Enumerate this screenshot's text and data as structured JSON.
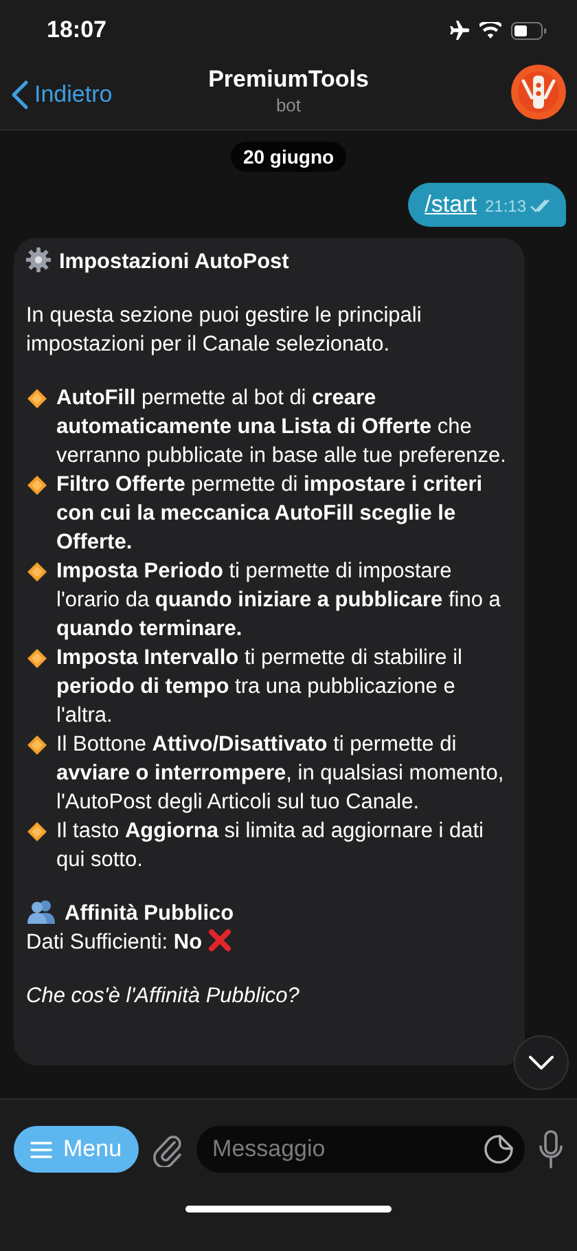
{
  "status_bar": {
    "time": "18:07"
  },
  "header": {
    "back": "Indietro",
    "title": "PremiumTools",
    "subtitle": "bot"
  },
  "date": "20 giugno",
  "outgoing": {
    "text": "/start",
    "time": "21:13"
  },
  "message": {
    "sections": [
      [
        {
          "kind": "settings_heading",
          "text": "Impostazioni AutoPost"
        }
      ],
      [
        {
          "kind": "text",
          "text": "In questa sezione puoi gestire le principali impostazioni per il Canale selezionato."
        }
      ],
      [
        {
          "kind": "bullet",
          "text": "**AutoFill** permette al bot di **creare automaticamente una Lista di Offerte** che verranno pubblicate in base alle tue preferenze."
        },
        {
          "kind": "bullet",
          "text": "**Filtro Offerte** permette di **impostare i criteri con cui la meccanica AutoFill sceglie le Offerte.**"
        },
        {
          "kind": "bullet",
          "text": "**Imposta Periodo** ti permette di impostare l'orario da **quando iniziare a pubblicare** fino a **quando terminare.**"
        },
        {
          "kind": "bullet",
          "text": "**Imposta Intervallo** ti permette di stabilire il **periodo di tempo** tra una pubblicazione e l'altra."
        },
        {
          "kind": "bullet",
          "text": "Il Bottone **Attivo/Disattivato** ti permette di **avviare o interrompere**, in qualsiasi momento, l'AutoPost degli Articoli sul tuo Canale."
        },
        {
          "kind": "bullet",
          "text": "Il tasto **Aggiorna** si limita ad aggiornare i dati qui sotto."
        }
      ],
      [
        {
          "kind": "audience_heading",
          "text": "Affinità Pubblico"
        },
        {
          "kind": "status_no",
          "text": "Dati Sufficienti: **No**"
        }
      ],
      [
        {
          "kind": "question",
          "text": "Che cos'è l'Affinità Pubblico?"
        }
      ]
    ]
  },
  "input_bar": {
    "menu": "Menu",
    "placeholder": "Messaggio"
  }
}
